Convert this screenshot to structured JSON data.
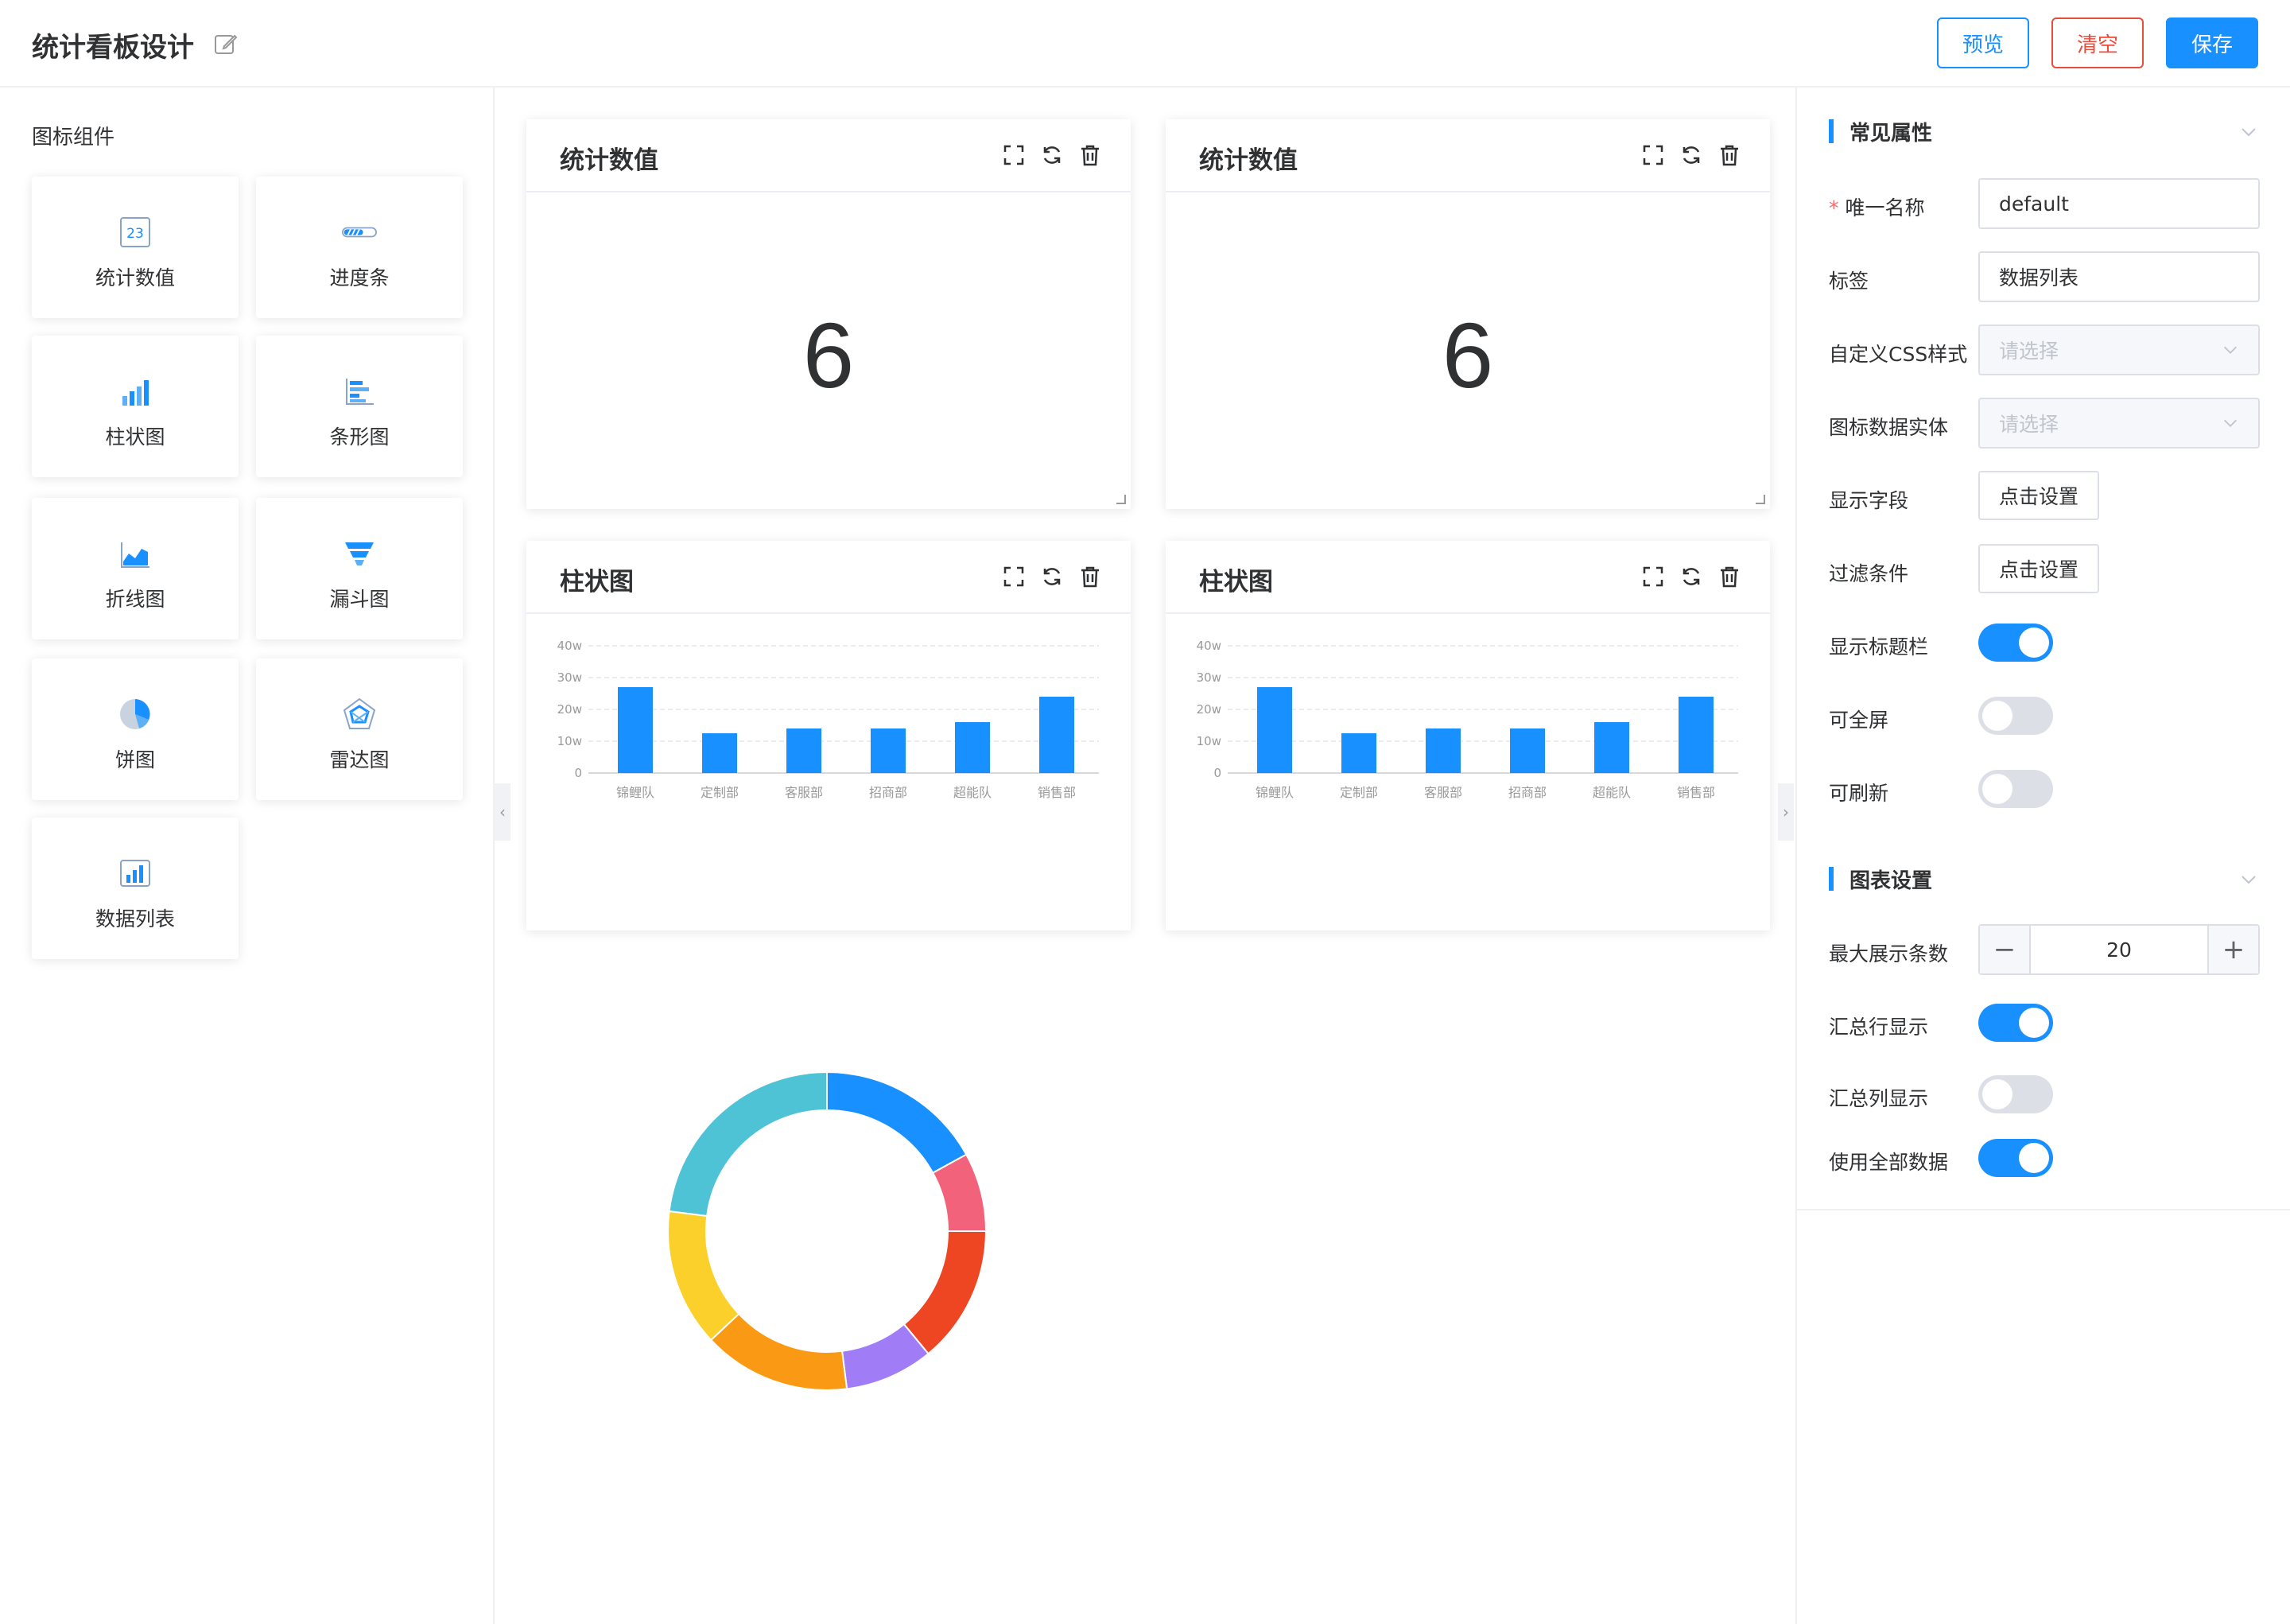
{
  "header": {
    "title": "统计看板设计",
    "preview_label": "预览",
    "clear_label": "清空",
    "save_label": "保存"
  },
  "left_panel": {
    "title": "图标组件",
    "components": [
      {
        "label": "统计数值",
        "icon": "stat-number-icon",
        "icon_text": "23"
      },
      {
        "label": "进度条",
        "icon": "progress-bar-icon"
      },
      {
        "label": "柱状图",
        "icon": "bar-chart-icon"
      },
      {
        "label": "条形图",
        "icon": "horizontal-bar-icon"
      },
      {
        "label": "折线图",
        "icon": "line-chart-icon"
      },
      {
        "label": "漏斗图",
        "icon": "funnel-icon"
      },
      {
        "label": "饼图",
        "icon": "pie-chart-icon"
      },
      {
        "label": "雷达图",
        "icon": "radar-chart-icon"
      },
      {
        "label": "数据列表",
        "icon": "data-list-icon"
      }
    ]
  },
  "widgets": {
    "stat1": {
      "title": "统计数值",
      "value": "6"
    },
    "stat2": {
      "title": "统计数值",
      "value": "6"
    },
    "bar1": {
      "title": "柱状图"
    },
    "bar2": {
      "title": "柱状图"
    }
  },
  "chart_data": [
    {
      "type": "bar",
      "categories": [
        "锦鲤队",
        "定制部",
        "客服部",
        "招商部",
        "超能队",
        "销售部"
      ],
      "values": [
        27,
        12.5,
        14,
        14,
        16,
        24
      ],
      "ytick_labels": [
        "0",
        "10w",
        "20w",
        "30w",
        "40w"
      ],
      "ylim": [
        0,
        40
      ],
      "color": "#1890ff"
    },
    {
      "type": "bar",
      "categories": [
        "锦鲤队",
        "定制部",
        "客服部",
        "招商部",
        "超能队",
        "销售部"
      ],
      "values": [
        27,
        12.5,
        14,
        14,
        16,
        24
      ],
      "ytick_labels": [
        "0",
        "10w",
        "20w",
        "30w",
        "40w"
      ],
      "ylim": [
        0,
        40
      ],
      "color": "#1890ff"
    },
    {
      "type": "pie",
      "values": [
        17,
        8,
        14,
        9,
        15,
        14,
        23
      ],
      "colors": [
        "#1890ff",
        "#f2637b",
        "#ee4522",
        "#a07cf7",
        "#fa9a14",
        "#fcd02a",
        "#4fc3d6"
      ]
    }
  ],
  "right_panel": {
    "common_section": "常见属性",
    "unique_name_label": "唯一名称",
    "unique_name_value": "default",
    "tag_label": "标签",
    "tag_value": "数据列表",
    "css_label": "自定义CSS样式",
    "css_placeholder": "请选择",
    "entity_label": "图标数据实体",
    "entity_placeholder": "请选择",
    "fields_label": "显示字段",
    "fields_button": "点击设置",
    "filter_label": "过滤条件",
    "filter_button": "点击设置",
    "show_title_label": "显示标题栏",
    "show_title_on": true,
    "fullscreen_label": "可全屏",
    "fullscreen_on": false,
    "refresh_label": "可刷新",
    "refresh_on": false,
    "chart_section": "图表设置",
    "max_rows_label": "最大展示条数",
    "max_rows_value": "20",
    "sum_row_label": "汇总行显示",
    "sum_row_on": true,
    "sum_col_label": "汇总列显示",
    "sum_col_on": false,
    "all_data_label": "使用全部数据",
    "all_data_on": true
  },
  "colors": {
    "accent": "#1890ff",
    "danger": "#e84c3d"
  }
}
